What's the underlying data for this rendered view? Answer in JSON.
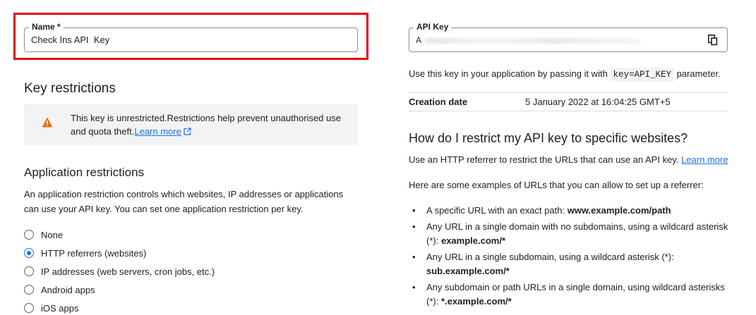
{
  "name_field": {
    "label": "Name *",
    "value": "Check Ins API  Key"
  },
  "key_restrictions": {
    "heading": "Key restrictions",
    "warning_text": "This key is unrestricted.Restrictions help prevent unauthorised use and quota theft.",
    "learn_more": "Learn more",
    "warning_icon": "warning-triangle-icon",
    "warning_color": "#e8710a"
  },
  "application_restrictions": {
    "heading": "Application restrictions",
    "description": "An application restriction controls which websites, IP addresses or applications can use your API key. You can set one application restriction per key.",
    "options": [
      {
        "label": "None",
        "checked": false
      },
      {
        "label": "HTTP referrers (websites)",
        "checked": true
      },
      {
        "label": "IP addresses (web servers, cron jobs, etc.)",
        "checked": false
      },
      {
        "label": "Android apps",
        "checked": false
      },
      {
        "label": "iOS apps",
        "checked": false
      }
    ]
  },
  "api_key": {
    "label": "API Key",
    "value_visible": "A",
    "copy_icon": "copy-icon",
    "usage_prefix": "Use this key in your application by passing it with",
    "usage_code": "key=API_KEY",
    "usage_suffix": "parameter."
  },
  "creation": {
    "label": "Creation date",
    "value": "5 January 2022 at 16:04:25 GMT+5"
  },
  "howto": {
    "heading": "How do I restrict my API key to specific websites?",
    "intro": "Use an HTTP referrer to restrict the URLs that can use an API key.",
    "learn_more": "Learn more",
    "examples_intro": "Here are some examples of URLs that you can allow to set up a referrer:",
    "examples": [
      {
        "text": "A specific URL with an exact path:",
        "bold": "www.example.com/path"
      },
      {
        "text": "Any URL in a single domain with no subdomains, using a wildcard asterisk (*):",
        "bold": "example.com/*"
      },
      {
        "text": "Any URL in a single subdomain, using a wildcard asterisk (*):",
        "bold": "sub.example.com/*"
      },
      {
        "text": "Any subdomain or path URLs in a single domain, using wildcard asterisks (*):",
        "bold": "*.example.com/*"
      }
    ]
  },
  "colors": {
    "accent": "#1a73e8",
    "highlight": "#e3001b"
  }
}
